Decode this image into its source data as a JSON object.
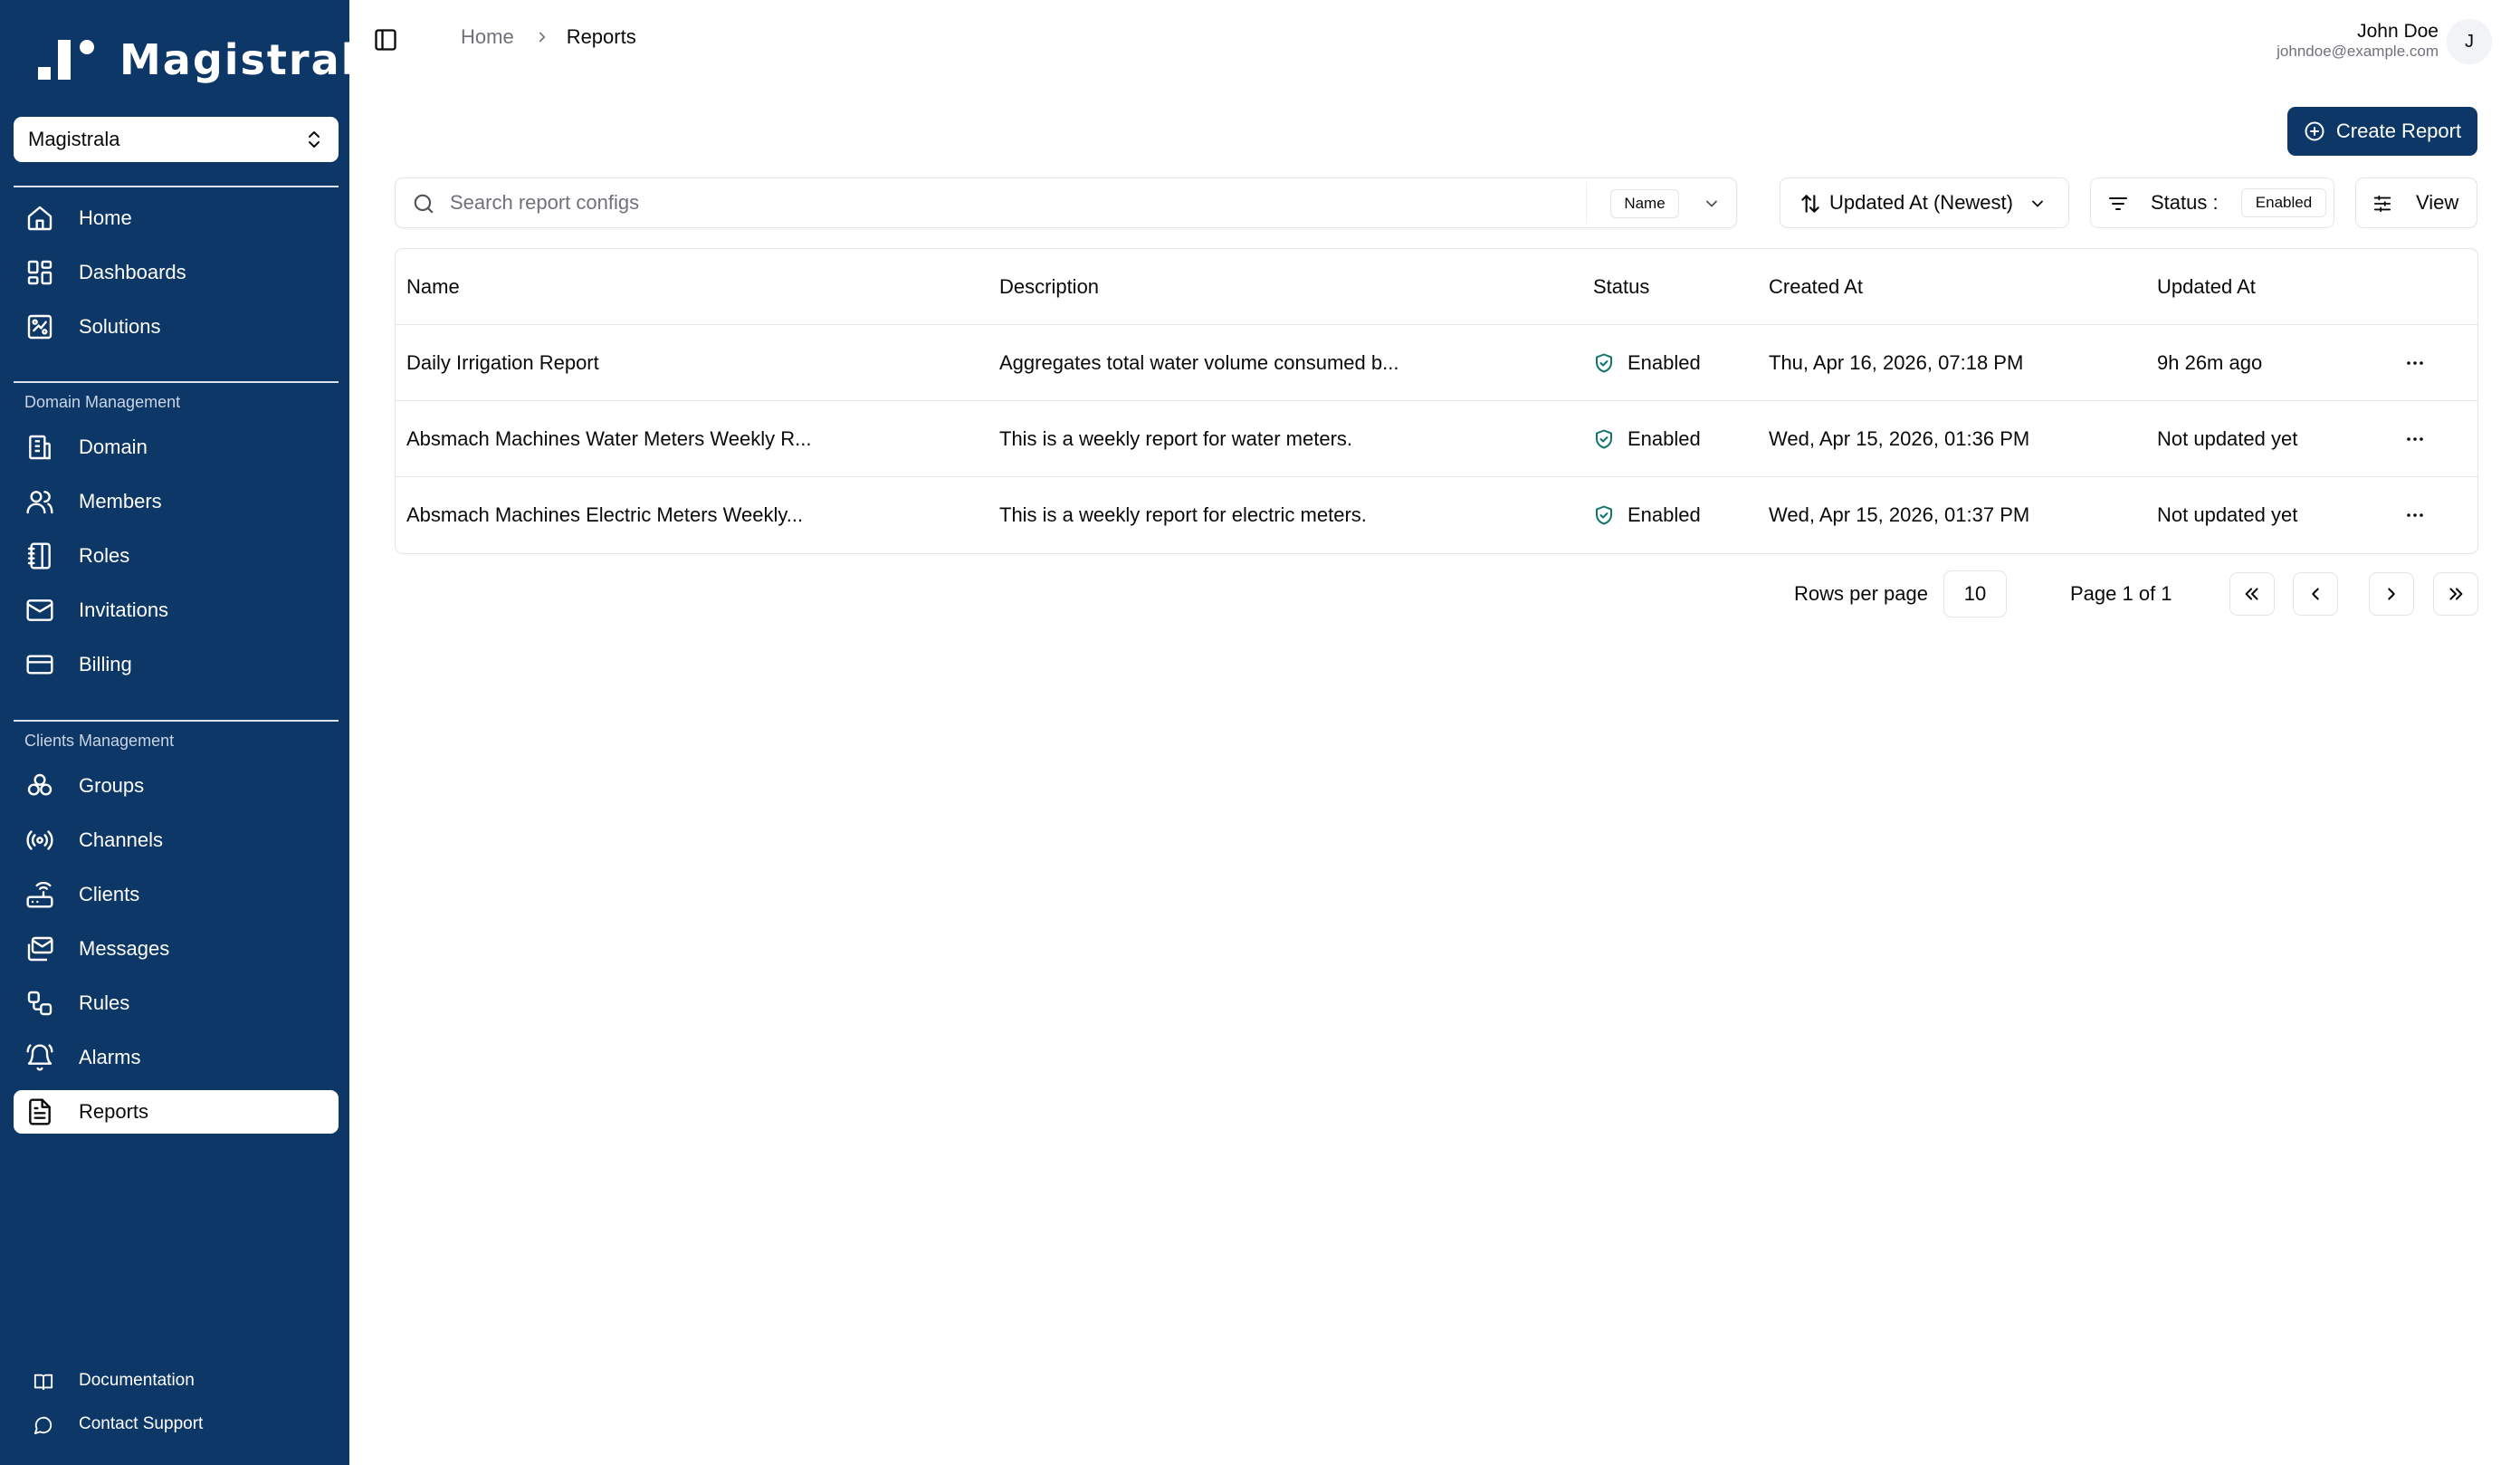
{
  "app": {
    "brand": "Magistrala",
    "domain_selector": "Magistrala"
  },
  "sidebar": {
    "main_items": [
      {
        "label": "Home",
        "icon": "home-icon"
      },
      {
        "label": "Dashboards",
        "icon": "dashboard-icon"
      },
      {
        "label": "Solutions",
        "icon": "solutions-icon"
      }
    ],
    "domain_group_label": "Domain Management",
    "domain_items": [
      {
        "label": "Domain",
        "icon": "building-icon"
      },
      {
        "label": "Members",
        "icon": "users-icon"
      },
      {
        "label": "Roles",
        "icon": "notebook-icon"
      },
      {
        "label": "Invitations",
        "icon": "mail-icon"
      },
      {
        "label": "Billing",
        "icon": "credit-card-icon"
      }
    ],
    "clients_group_label": "Clients Management",
    "clients_items": [
      {
        "label": "Groups",
        "icon": "groups-icon"
      },
      {
        "label": "Channels",
        "icon": "radio-icon"
      },
      {
        "label": "Clients",
        "icon": "router-icon"
      },
      {
        "label": "Messages",
        "icon": "messages-icon"
      },
      {
        "label": "Rules",
        "icon": "workflow-icon"
      },
      {
        "label": "Alarms",
        "icon": "bell-ring-icon"
      },
      {
        "label": "Reports",
        "icon": "file-text-icon",
        "active": true
      }
    ],
    "footer_items": [
      {
        "label": "Documentation",
        "icon": "book-icon"
      },
      {
        "label": "Contact Support",
        "icon": "chat-icon"
      }
    ]
  },
  "header": {
    "breadcrumb_home": "Home",
    "breadcrumb_current": "Reports",
    "user_name": "John Doe",
    "user_email": "johndoe@example.com",
    "avatar_initial": "J"
  },
  "toolbar": {
    "create_label": "Create Report",
    "search_placeholder": "Search report configs",
    "search_value": "",
    "search_field": "Name",
    "sort_label": "Updated At (Newest)",
    "status_label": "Status :",
    "status_value": "Enabled",
    "view_label": "View"
  },
  "table": {
    "columns": [
      "Name",
      "Description",
      "Status",
      "Created At",
      "Updated At"
    ],
    "rows": [
      {
        "name": "Daily Irrigation Report",
        "description": "Aggregates total water volume consumed b...",
        "status": "Enabled",
        "created_at": "Thu, Apr 16, 2026, 07:18 PM",
        "updated_at": "9h 26m ago"
      },
      {
        "name": "Absmach Machines Water Meters Weekly R...",
        "description": "This is a weekly report for water meters.",
        "status": "Enabled",
        "created_at": "Wed, Apr 15, 2026, 01:36 PM",
        "updated_at": "Not updated yet"
      },
      {
        "name": "Absmach Machines Electric Meters Weekly...",
        "description": "This is a weekly report for electric meters.",
        "status": "Enabled",
        "created_at": "Wed, Apr 15, 2026, 01:37 PM",
        "updated_at": "Not updated yet"
      }
    ]
  },
  "pagination": {
    "rows_per_page_label": "Rows per page",
    "rows_per_page": "10",
    "page_info": "Page 1 of 1"
  },
  "colors": {
    "sidebar_bg": "#0d3766",
    "primary": "#0d3766",
    "status_enabled": "#0f766e",
    "border": "#e4e4e7",
    "muted_text": "#71717a"
  }
}
